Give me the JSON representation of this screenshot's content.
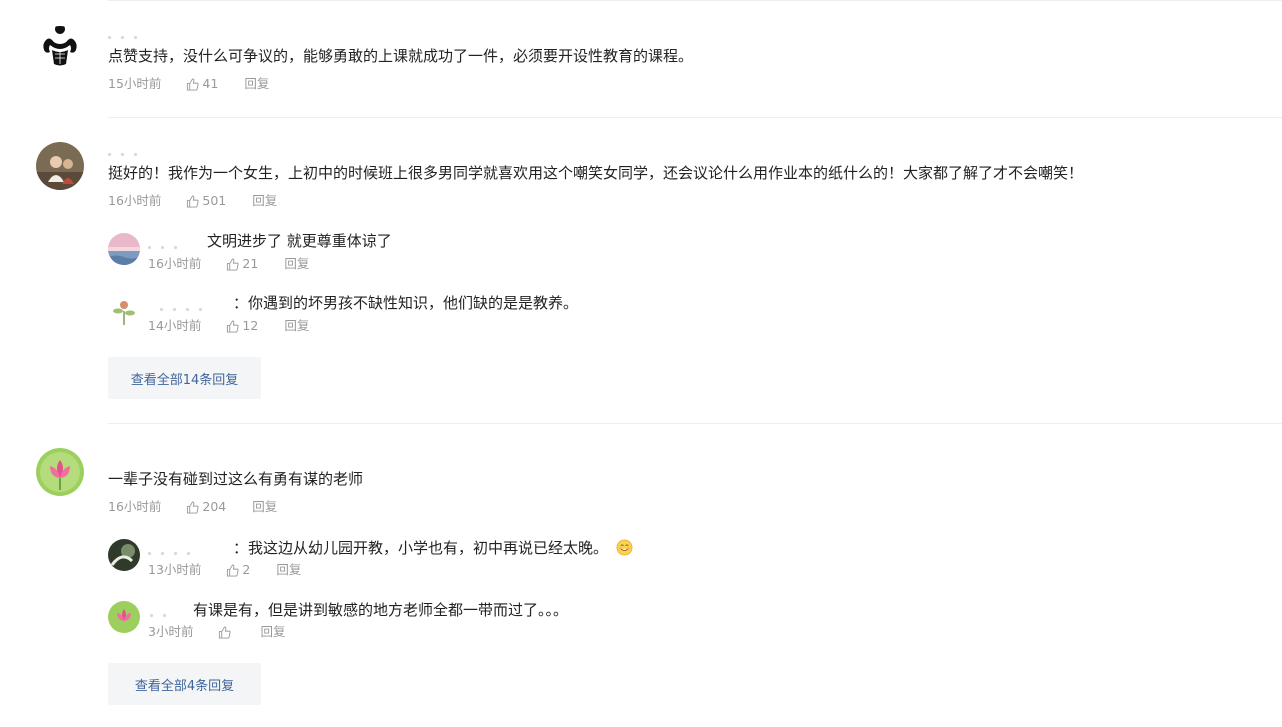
{
  "comments": [
    {
      "text": "点赞支持，没什么可争议的，能够勇敢的上课就成功了一件，必须要开设性教育的课程。",
      "time": "15小时前",
      "likes": "41",
      "reply_label": "回复"
    },
    {
      "text": "挺好的！我作为一个女生，上初中的时候班上很多男同学就喜欢用这个嘲笑女同学，还会议论什么用作业本的纸什么的！大家都了解了才不会嘲笑！",
      "time": "16小时前",
      "likes": "501",
      "reply_label": "回复",
      "replies": [
        {
          "text": "文明进步了 就更尊重体谅了",
          "time": "16小时前",
          "likes": "21",
          "reply_label": "回复"
        },
        {
          "text": "：你遇到的坏男孩不缺性知识，他们缺的是是教养。",
          "time": "14小时前",
          "likes": "12",
          "reply_label": "回复"
        }
      ],
      "view_all": "查看全部14条回复"
    },
    {
      "text": "一辈子没有碰到过这么有勇有谋的老师",
      "time": "16小时前",
      "likes": "204",
      "reply_label": "回复",
      "replies": [
        {
          "text": "：我这边从幼儿园开教，小学也有，初中再说已经太晚。",
          "time": "13小时前",
          "likes": "2",
          "reply_label": "回复"
        },
        {
          "text": "有课是有，但是讲到敏感的地方老师全都一带而过了。。。",
          "time": "3小时前",
          "likes": "",
          "reply_label": "回复"
        }
      ],
      "view_all": "查看全部4条回复"
    }
  ],
  "colors": {
    "link": "#406599",
    "meta": "#999999",
    "text": "#222222",
    "divider": "#eeeeee"
  },
  "icons": [
    "thumbs-up-icon",
    "smile-emoji-icon"
  ]
}
